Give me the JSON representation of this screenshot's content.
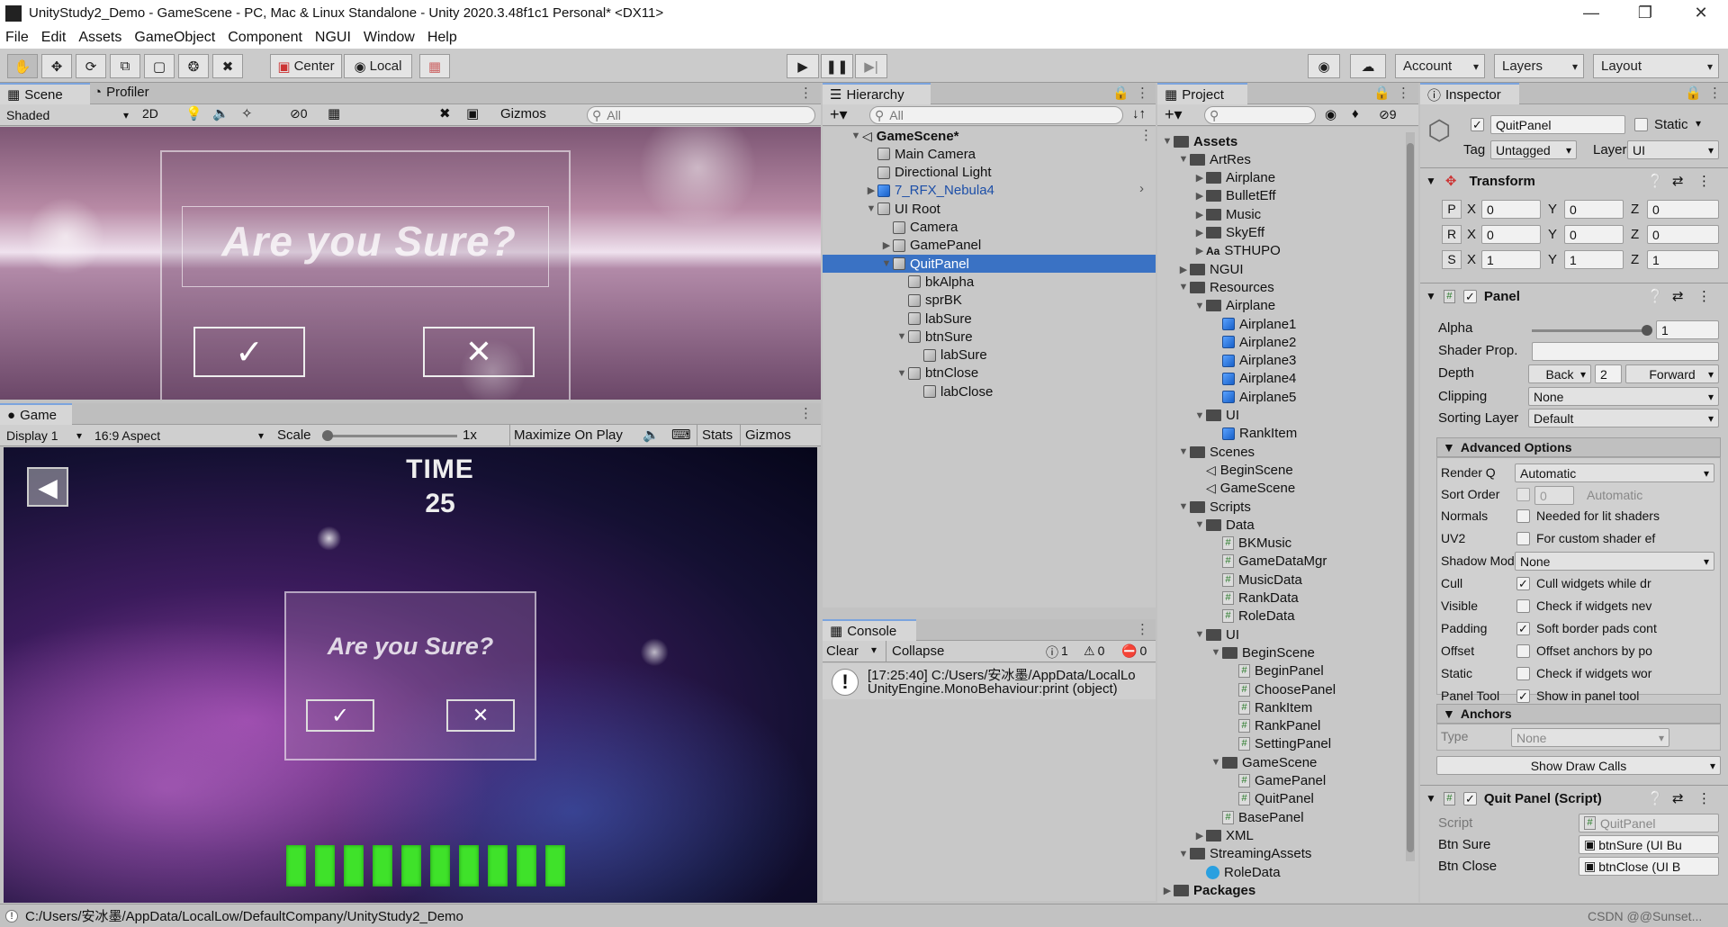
{
  "window": {
    "title": "UnityStudy2_Demo - GameScene - PC, Mac & Linux Standalone - Unity 2020.3.48f1c1 Personal* <DX11>"
  },
  "menu": [
    "File",
    "Edit",
    "Assets",
    "GameObject",
    "Component",
    "NGUI",
    "Window",
    "Help"
  ],
  "toolbar": {
    "center": "Center",
    "local": "Local",
    "account": "Account",
    "layers": "Layers",
    "layout": "Layout"
  },
  "scene": {
    "tab": "Scene",
    "profiler_tab": "Profiler",
    "shading": "Shaded",
    "mode_2d": "2D",
    "gizmo_count": "0",
    "gizmos": "Gizmos",
    "search_placeholder": "All",
    "dialog_title": "Are you Sure?"
  },
  "game": {
    "tab": "Game",
    "display": "Display 1",
    "aspect": "16:9 Aspect",
    "scale_label": "Scale",
    "scale_value": "1x",
    "maximize": "Maximize On Play",
    "stats": "Stats",
    "gizmos": "Gizmos",
    "time_label": "TIME",
    "time_value": "25",
    "dialog_title": "Are you Sure?",
    "progress_blocks": 10
  },
  "hierarchy": {
    "tab": "Hierarchy",
    "search_placeholder": "All",
    "items": [
      {
        "label": "GameScene*",
        "depth": 0,
        "icon": "scene",
        "arrow": "open"
      },
      {
        "label": "Main Camera",
        "depth": 1,
        "icon": "cube",
        "arrow": ""
      },
      {
        "label": "Directional Light",
        "depth": 1,
        "icon": "cube",
        "arrow": ""
      },
      {
        "label": "7_RFX_Nebula4",
        "depth": 1,
        "icon": "prefab",
        "arrow": "closed"
      },
      {
        "label": "UI Root",
        "depth": 1,
        "icon": "cube",
        "arrow": "open"
      },
      {
        "label": "Camera",
        "depth": 2,
        "icon": "cube",
        "arrow": ""
      },
      {
        "label": "GamePanel",
        "depth": 2,
        "icon": "cube",
        "arrow": "closed"
      },
      {
        "label": "QuitPanel",
        "depth": 2,
        "icon": "cube",
        "arrow": "open",
        "selected": true
      },
      {
        "label": "bkAlpha",
        "depth": 3,
        "icon": "cube",
        "arrow": ""
      },
      {
        "label": "sprBK",
        "depth": 3,
        "icon": "cube",
        "arrow": ""
      },
      {
        "label": "labSure",
        "depth": 3,
        "icon": "cube",
        "arrow": ""
      },
      {
        "label": "btnSure",
        "depth": 3,
        "icon": "cube",
        "arrow": "open"
      },
      {
        "label": "labSure",
        "depth": 4,
        "icon": "cube",
        "arrow": ""
      },
      {
        "label": "btnClose",
        "depth": 3,
        "icon": "cube",
        "arrow": "open"
      },
      {
        "label": "labClose",
        "depth": 4,
        "icon": "cube",
        "arrow": ""
      }
    ]
  },
  "console": {
    "tab": "Console",
    "clear": "Clear",
    "collapse": "Collapse",
    "counts": {
      "log": "1",
      "warn": "0",
      "error": "0"
    },
    "message_line1": "[17:25:40] C:/Users/安冰墨/AppData/LocalLo",
    "message_line2": "UnityEngine.MonoBehaviour:print (object)"
  },
  "project": {
    "tab": "Project",
    "hidden_count": "9",
    "items": [
      {
        "label": "Assets",
        "depth": 0,
        "icon": "folder",
        "arrow": "open",
        "bold": true
      },
      {
        "label": "ArtRes",
        "depth": 1,
        "icon": "folder",
        "arrow": "open"
      },
      {
        "label": "Airplane",
        "depth": 2,
        "icon": "folder",
        "arrow": "closed"
      },
      {
        "label": "BulletEff",
        "depth": 2,
        "icon": "folder",
        "arrow": "closed"
      },
      {
        "label": "Music",
        "depth": 2,
        "icon": "folder",
        "arrow": "closed"
      },
      {
        "label": "SkyEff",
        "depth": 2,
        "icon": "folder",
        "arrow": "closed"
      },
      {
        "label": "STHUPO",
        "depth": 2,
        "icon": "font",
        "arrow": "closed"
      },
      {
        "label": "NGUI",
        "depth": 1,
        "icon": "folder",
        "arrow": "closed"
      },
      {
        "label": "Resources",
        "depth": 1,
        "icon": "folder",
        "arrow": "open"
      },
      {
        "label": "Airplane",
        "depth": 2,
        "icon": "folder",
        "arrow": "open"
      },
      {
        "label": "Airplane1",
        "depth": 3,
        "icon": "prefab",
        "arrow": ""
      },
      {
        "label": "Airplane2",
        "depth": 3,
        "icon": "prefab",
        "arrow": ""
      },
      {
        "label": "Airplane3",
        "depth": 3,
        "icon": "prefab",
        "arrow": ""
      },
      {
        "label": "Airplane4",
        "depth": 3,
        "icon": "prefab",
        "arrow": ""
      },
      {
        "label": "Airplane5",
        "depth": 3,
        "icon": "prefab",
        "arrow": ""
      },
      {
        "label": "UI",
        "depth": 2,
        "icon": "folder",
        "arrow": "open"
      },
      {
        "label": "RankItem",
        "depth": 3,
        "icon": "prefab",
        "arrow": ""
      },
      {
        "label": "Scenes",
        "depth": 1,
        "icon": "folder",
        "arrow": "open"
      },
      {
        "label": "BeginScene",
        "depth": 2,
        "icon": "scene",
        "arrow": ""
      },
      {
        "label": "GameScene",
        "depth": 2,
        "icon": "scene",
        "arrow": ""
      },
      {
        "label": "Scripts",
        "depth": 1,
        "icon": "folder",
        "arrow": "open"
      },
      {
        "label": "Data",
        "depth": 2,
        "icon": "folder",
        "arrow": "open"
      },
      {
        "label": "BKMusic",
        "depth": 3,
        "icon": "script",
        "arrow": ""
      },
      {
        "label": "GameDataMgr",
        "depth": 3,
        "icon": "script",
        "arrow": ""
      },
      {
        "label": "MusicData",
        "depth": 3,
        "icon": "script",
        "arrow": ""
      },
      {
        "label": "RankData",
        "depth": 3,
        "icon": "script",
        "arrow": ""
      },
      {
        "label": "RoleData",
        "depth": 3,
        "icon": "script",
        "arrow": ""
      },
      {
        "label": "UI",
        "depth": 2,
        "icon": "folder",
        "arrow": "open"
      },
      {
        "label": "BeginScene",
        "depth": 3,
        "icon": "folder",
        "arrow": "open"
      },
      {
        "label": "BeginPanel",
        "depth": 4,
        "icon": "script",
        "arrow": ""
      },
      {
        "label": "ChoosePanel",
        "depth": 4,
        "icon": "script",
        "arrow": ""
      },
      {
        "label": "RankItem",
        "depth": 4,
        "icon": "script",
        "arrow": ""
      },
      {
        "label": "RankPanel",
        "depth": 4,
        "icon": "script",
        "arrow": ""
      },
      {
        "label": "SettingPanel",
        "depth": 4,
        "icon": "script",
        "arrow": ""
      },
      {
        "label": "GameScene",
        "depth": 3,
        "icon": "folder",
        "arrow": "open"
      },
      {
        "label": "GamePanel",
        "depth": 4,
        "icon": "script",
        "arrow": ""
      },
      {
        "label": "QuitPanel",
        "depth": 4,
        "icon": "script",
        "arrow": ""
      },
      {
        "label": "BasePanel",
        "depth": 3,
        "icon": "script",
        "arrow": ""
      },
      {
        "label": "XML",
        "depth": 2,
        "icon": "folder",
        "arrow": "closed"
      },
      {
        "label": "StreamingAssets",
        "depth": 1,
        "icon": "folder",
        "arrow": "open"
      },
      {
        "label": "RoleData",
        "depth": 2,
        "icon": "web",
        "arrow": ""
      },
      {
        "label": "Packages",
        "depth": 0,
        "icon": "folder",
        "arrow": "closed",
        "bold": true
      }
    ]
  },
  "inspector": {
    "tab": "Inspector",
    "object_name": "QuitPanel",
    "static_label": "Static",
    "tag_label": "Tag",
    "tag_value": "Untagged",
    "layer_label": "Layer",
    "layer_value": "UI",
    "transform": {
      "title": "Transform",
      "rows": [
        {
          "label": "P",
          "x": "0",
          "y": "0",
          "z": "0"
        },
        {
          "label": "R",
          "x": "0",
          "y": "0",
          "z": "0"
        },
        {
          "label": "S",
          "x": "1",
          "y": "1",
          "z": "1"
        }
      ]
    },
    "panel": {
      "title": "Panel",
      "alpha_label": "Alpha",
      "alpha_value": "1",
      "shader_label": "Shader Prop.",
      "depth_label": "Depth",
      "depth_back": "Back",
      "depth_value": "2",
      "depth_forward": "Forward",
      "clipping_label": "Clipping",
      "clipping_value": "None",
      "sorting_label": "Sorting Layer",
      "sorting_value": "Default",
      "advanced_title": "Advanced Options",
      "renderq_label": "Render Q",
      "renderq_value": "Automatic",
      "sortorder_label": "Sort Order",
      "sortorder_value": "0",
      "sortorder_hint": "Automatic",
      "options": [
        {
          "label": "Normals",
          "checked": false,
          "desc": "Needed for lit shaders"
        },
        {
          "label": "UV2",
          "checked": false,
          "desc": "For custom shader ef"
        },
        {
          "label": "Shadow Mode",
          "dropdown": "None"
        },
        {
          "label": "Cull",
          "checked": true,
          "desc": "Cull widgets while dr"
        },
        {
          "label": "Visible",
          "checked": false,
          "desc": "Check if widgets nev"
        },
        {
          "label": "Padding",
          "checked": true,
          "desc": "Soft border pads cont"
        },
        {
          "label": "Offset",
          "checked": false,
          "desc": "Offset anchors by po"
        },
        {
          "label": "Static",
          "checked": false,
          "desc": "Check if widgets wor"
        },
        {
          "label": "Panel Tool",
          "checked": true,
          "desc": "Show in panel tool"
        }
      ],
      "anchors_title": "Anchors",
      "type_label": "Type",
      "type_value": "None",
      "draw_calls_button": "Show Draw Calls"
    },
    "script": {
      "title": "Quit Panel (Script)",
      "script_label": "Script",
      "script_value": "QuitPanel",
      "btnsure_label": "Btn Sure",
      "btnsure_value": "btnSure (UI Bu",
      "btnclose_label": "Btn Close",
      "btnclose_value": "btnClose (UI B"
    }
  },
  "status": {
    "path": "C:/Users/安冰墨/AppData/LocalLow/DefaultCompany/UnityStudy2_Demo",
    "watermark": "CSDN @@Sunset..."
  },
  "colors": {
    "selection": "#3a72c4",
    "tab_accent": "#7ba4de",
    "progress_green": "#3fe22a"
  }
}
